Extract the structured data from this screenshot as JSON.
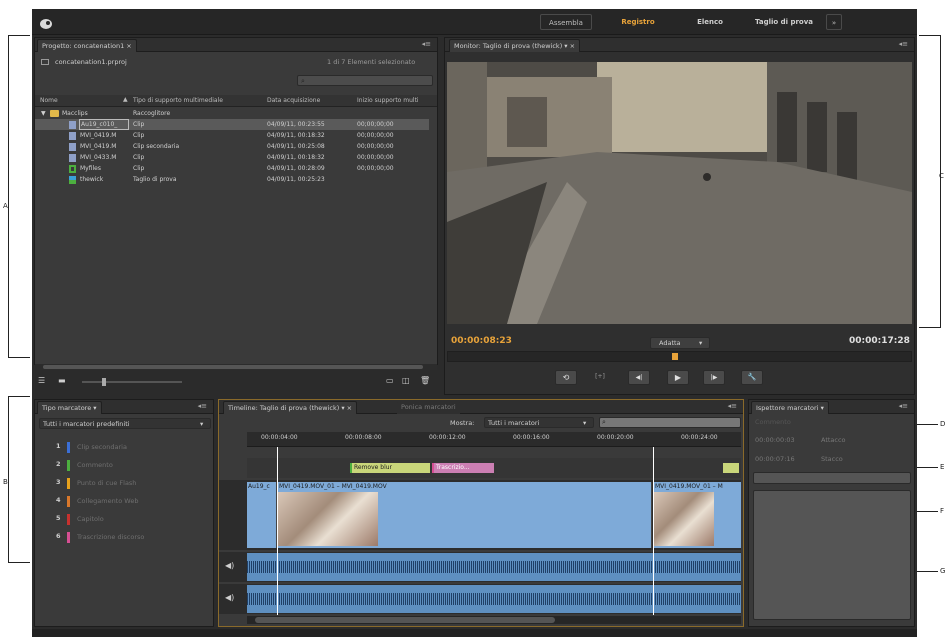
{
  "callouts": {
    "a": "A",
    "b": "B",
    "c": "C",
    "d": "D",
    "e": "E",
    "f": "F",
    "g": "G"
  },
  "workspaces": {
    "tabs": [
      "Assembla",
      "Registro",
      "Elenco",
      "Taglio di prova"
    ],
    "active": "Registro",
    "more": "»"
  },
  "project": {
    "tab": "Progetto: concatenation1 ×",
    "file": "concatenation1.prproj",
    "count": "1 di 7 Elementi selezionato",
    "columns": [
      "Nome",
      "Tipo di supporto multimediale",
      "Data acquisizione",
      "Inizio supporto multi"
    ],
    "rows": [
      {
        "name": "Macclips",
        "type": "Raccoglitore",
        "date": "",
        "start": "",
        "icon": "bin",
        "level": 0
      },
      {
        "name": "Au19_c010_",
        "type": "Clip",
        "date": "04/09/11, 00:23:55",
        "start": "00;00;00;00",
        "icon": "clip",
        "level": 1
      },
      {
        "name": "MVI_0419.M",
        "type": "Clip",
        "date": "04/09/11, 00:18:32",
        "start": "00;00;00;00",
        "icon": "clip",
        "level": 1
      },
      {
        "name": "MVI_0419.M",
        "type": "Clip secondaria",
        "date": "04/09/11, 00:25:08",
        "start": "00;00;00;00",
        "icon": "clip",
        "level": 1
      },
      {
        "name": "MVI_0433.M",
        "type": "Clip",
        "date": "04/09/11, 00:18:32",
        "start": "00;00;00;00",
        "icon": "clip",
        "level": 1
      },
      {
        "name": "Myfiles",
        "type": "Clip",
        "date": "04/09/11, 00:28:09",
        "start": "00;00;00;00",
        "icon": "clip-green",
        "level": 1
      },
      {
        "name": "thewick",
        "type": "Taglio di prova",
        "date": "04/09/11, 00:25:23",
        "start": "",
        "icon": "sequence",
        "level": 1
      }
    ]
  },
  "monitor": {
    "tab": "Monitor: Taglio di prova (thewick) ▾ ×",
    "current_tc": "00:00:08:23",
    "duration_tc": "00:00:17:28",
    "fit": "Adatta",
    "transport": [
      {
        "name": "loop-icon",
        "glyph": "⟲"
      },
      {
        "name": "safe-margins-icon",
        "glyph": "[+]"
      },
      {
        "name": "step-back-icon",
        "glyph": "◀|"
      },
      {
        "name": "play-icon",
        "glyph": "▶"
      },
      {
        "name": "step-forward-icon",
        "glyph": "|▶"
      },
      {
        "name": "wrench-icon",
        "glyph": "🔧"
      }
    ]
  },
  "marker_types": {
    "tab": "Tipo marcatore ▾",
    "dropdown": "Tutti i marcatori predefiniti",
    "items": [
      {
        "num": "1",
        "label": "Clip secondaria",
        "color": "#3b6fd6"
      },
      {
        "num": "2",
        "label": "Commento",
        "color": "#4caf3f"
      },
      {
        "num": "3",
        "label": "Punto di cue Flash",
        "color": "#e6a11c"
      },
      {
        "num": "4",
        "label": "Collegamento Web",
        "color": "#d9782b"
      },
      {
        "name": "",
        "num": "5",
        "label": "Capitolo",
        "color": "#c8312e"
      },
      {
        "num": "6",
        "label": "Trascrizione discorso",
        "color": "#d64f93"
      }
    ]
  },
  "timeline": {
    "tab": "Timeline: Taglio di prova (thewick) ▾ ×",
    "tab2": "Ponica marcatori",
    "show_label": "Mostra:",
    "show_value": "Tutti i marcatori",
    "ruler": [
      "00:00:04:00",
      "00:00:08:00",
      "00:00:12:00",
      "00:00:16:00",
      "00:00:20:00",
      "00:00:24:00"
    ],
    "markers": [
      {
        "label": "Remove blur"
      },
      {
        "label": "Trascrizio..."
      }
    ],
    "clips": [
      {
        "label": "Au19_c"
      },
      {
        "label": "MVI_0419.MOV_01 – MVI_0419.MOV"
      },
      {
        "label": "MVI_0419.MOV_01 – M"
      }
    ]
  },
  "inspector": {
    "tab": "Ispettore marcatori ▾",
    "faded": "Commento",
    "rows": [
      {
        "tc": "00:00:00:03",
        "val": "Attacco"
      },
      {
        "tc": "00:00:07:16",
        "val": "Stacco"
      }
    ]
  }
}
